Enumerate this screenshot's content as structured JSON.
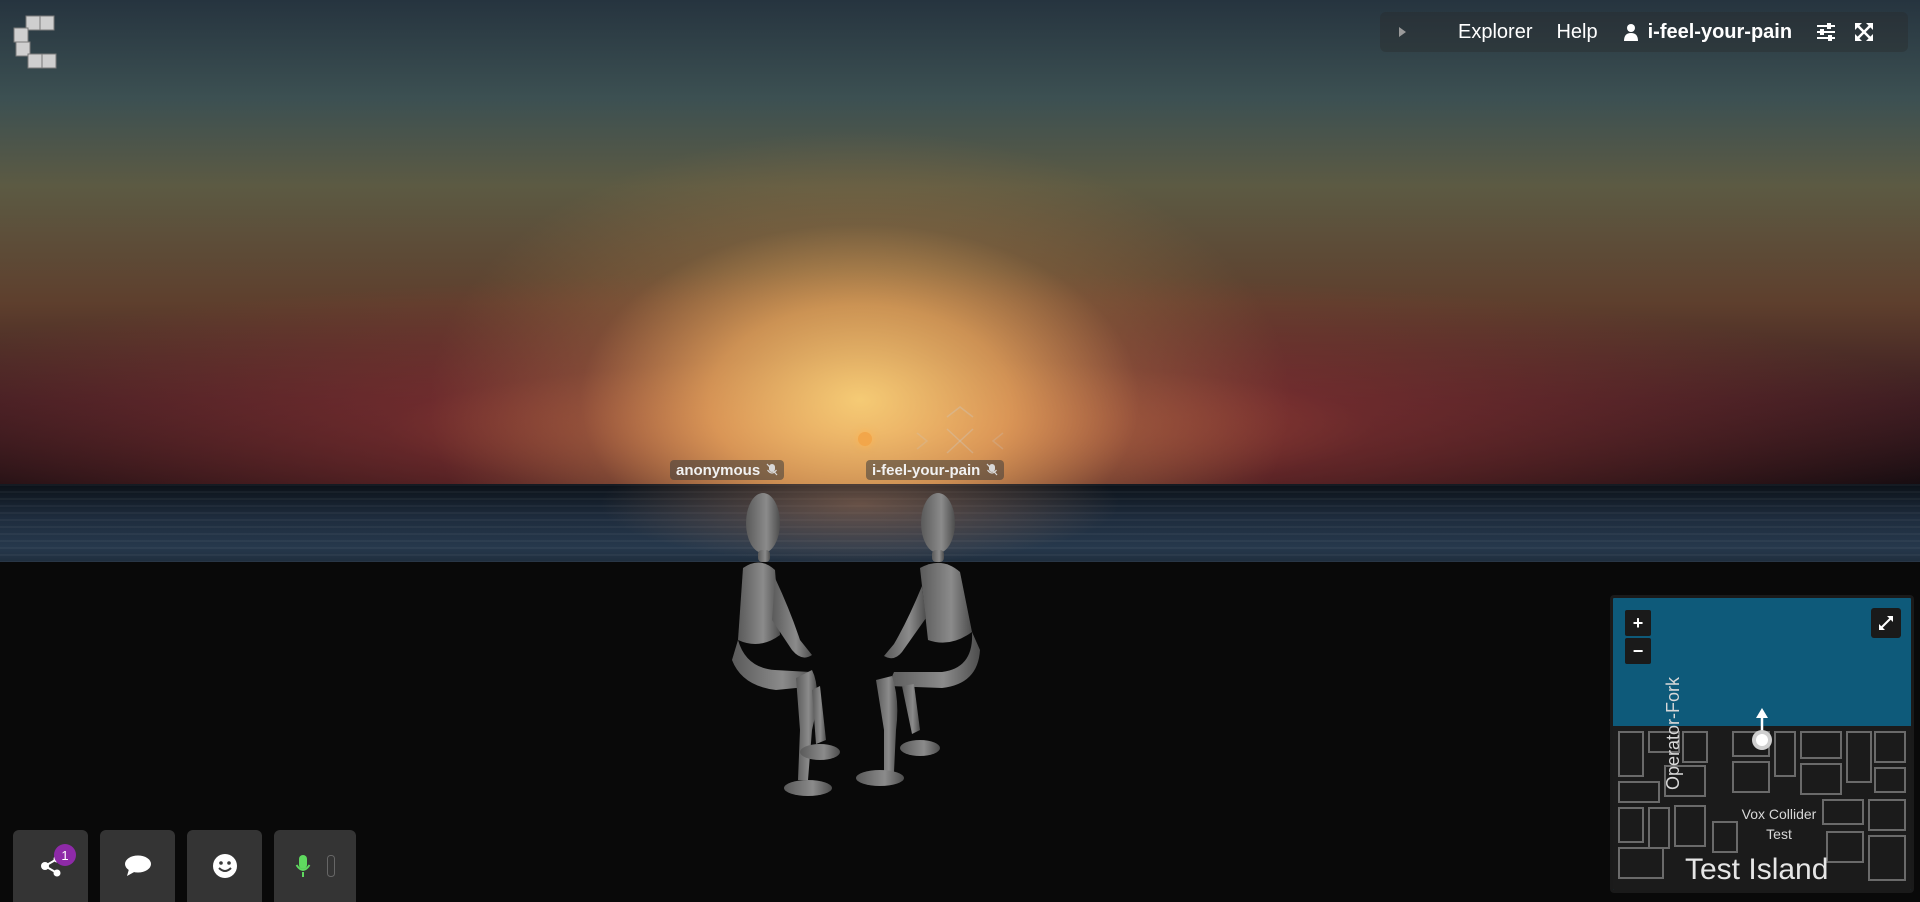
{
  "topbar": {
    "nav": [
      {
        "label": "Explorer"
      },
      {
        "label": "Help"
      }
    ],
    "username": "i-feel-your-pain",
    "icons": [
      "chevron-right-icon",
      "user-icon",
      "sliders-icon",
      "fullscreen-icon"
    ]
  },
  "logo": {
    "name": "voxel-logo"
  },
  "scene": {
    "nameplates": [
      {
        "label": "anonymous"
      },
      {
        "label": "i-feel-your-pain"
      }
    ]
  },
  "toolbar": {
    "share_badge": "1",
    "buttons": [
      "share-icon",
      "chat-icon",
      "emoji-icon",
      "microphone-icon"
    ]
  },
  "minimap": {
    "zoom_in": "+",
    "zoom_out": "−",
    "street_label": "Operator-Fork",
    "poi_label": "Vox Collider Test",
    "island_label": "Test Island"
  },
  "colors": {
    "badge": "#8e2aa8",
    "mic_active": "#5fd95f",
    "water": "#0e5a7a"
  }
}
